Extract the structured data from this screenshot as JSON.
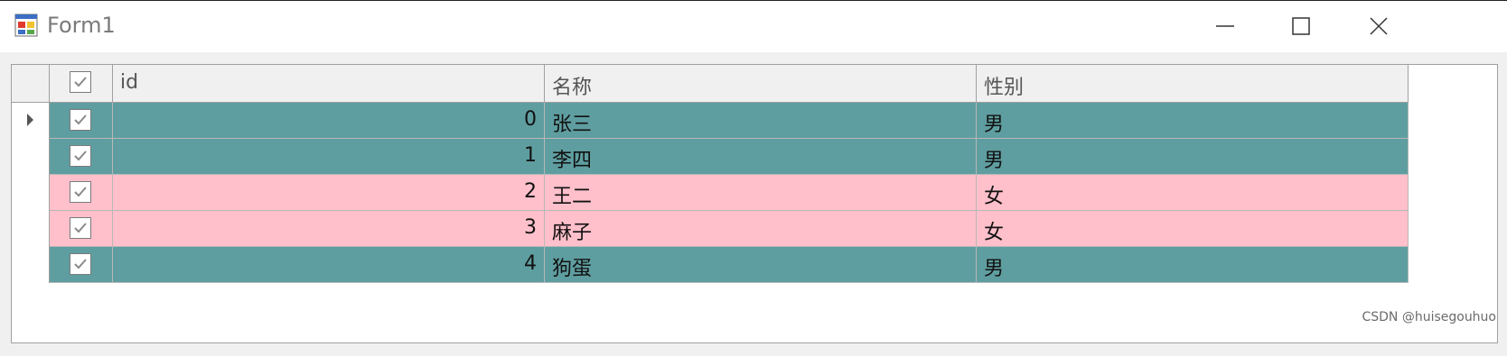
{
  "window": {
    "title": "Form1"
  },
  "grid": {
    "columns": [
      {
        "label": ""
      },
      {
        "label": "id"
      },
      {
        "label": "名称"
      },
      {
        "label": "性别"
      }
    ],
    "header_checked": true,
    "rows": [
      {
        "checked": true,
        "id": "0",
        "name": "张三",
        "gender": "男",
        "bg": "#5f9ea0",
        "current": true
      },
      {
        "checked": true,
        "id": "1",
        "name": "李四",
        "gender": "男",
        "bg": "#5f9ea0",
        "current": false
      },
      {
        "checked": true,
        "id": "2",
        "name": "王二",
        "gender": "女",
        "bg": "#ffc0cb",
        "current": false
      },
      {
        "checked": true,
        "id": "3",
        "name": "麻子",
        "gender": "女",
        "bg": "#ffc0cb",
        "current": false
      },
      {
        "checked": true,
        "id": "4",
        "name": "狗蛋",
        "gender": "男",
        "bg": "#5f9ea0",
        "current": false
      }
    ]
  },
  "watermark": "CSDN @huisegouhuo",
  "icons": {
    "app": "form-app-icon",
    "minimize": "minimize-icon",
    "maximize": "maximize-icon",
    "close": "close-icon",
    "check": "checkmark-icon",
    "row_pointer": "current-row-arrow-icon"
  }
}
